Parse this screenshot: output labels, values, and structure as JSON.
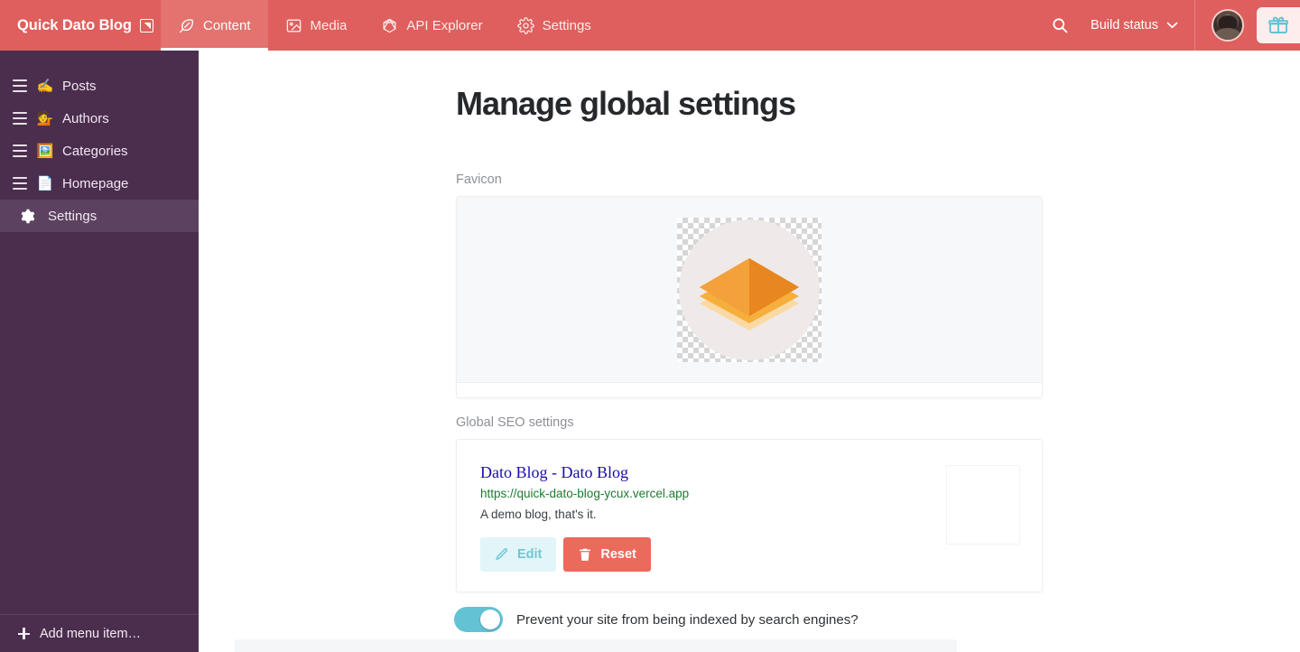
{
  "topbar": {
    "brand": "Quick Dato Blog",
    "brand_icon": "external-link-icon",
    "nav": [
      {
        "label": "Content",
        "icon": "feather-icon",
        "active": true
      },
      {
        "label": "Media",
        "icon": "image-icon",
        "active": false
      },
      {
        "label": "API Explorer",
        "icon": "graphql-icon",
        "active": false
      },
      {
        "label": "Settings",
        "icon": "gear-icon",
        "active": false
      }
    ],
    "search_icon": "search-icon",
    "build_status_label": "Build status",
    "build_status_chevron": "chevron-down-icon",
    "avatar": "user-avatar",
    "gift_icon": "gift-icon",
    "bg_color": "#de5f5d",
    "active_tab_color": "#e4726f"
  },
  "sidebar": {
    "bg_color": "#4b2e4e",
    "active_bg_color": "#5c4260",
    "items": [
      {
        "label": "Posts",
        "emoji": "✍️",
        "icon": "writing-hand-icon",
        "handle": true,
        "active": false
      },
      {
        "label": "Authors",
        "emoji": "💁",
        "icon": "person-icon",
        "handle": true,
        "active": false
      },
      {
        "label": "Categories",
        "emoji": "🖼️",
        "icon": "picture-icon",
        "handle": true,
        "active": false
      },
      {
        "label": "Homepage",
        "emoji": "📄",
        "icon": "page-icon",
        "handle": true,
        "active": false
      },
      {
        "label": "Settings",
        "emoji": "",
        "icon": "gear-icon",
        "handle": false,
        "active": true
      }
    ],
    "footer": {
      "label": "Add menu item…",
      "icon": "plus-icon"
    }
  },
  "main": {
    "page_title": "Manage global settings",
    "favicon_field": {
      "label": "Favicon",
      "image_alt": "orange-layered-diamond-favicon"
    },
    "seo_field": {
      "label": "Global SEO settings",
      "preview": {
        "title": "Dato Blog - Dato Blog",
        "url": "https://quick-dato-blog-ycux.vercel.app",
        "description": "A demo blog, that's it.",
        "thumbnail": "empty-thumbnail-placeholder"
      },
      "buttons": [
        {
          "label": "Edit",
          "icon": "pencil-icon",
          "style": "edit"
        },
        {
          "label": "Reset",
          "icon": "trash-icon",
          "style": "reset"
        }
      ]
    },
    "index_toggle": {
      "label": "Prevent your site from being indexed by search engines?",
      "enabled": true,
      "on_color": "#63c2d4"
    }
  }
}
